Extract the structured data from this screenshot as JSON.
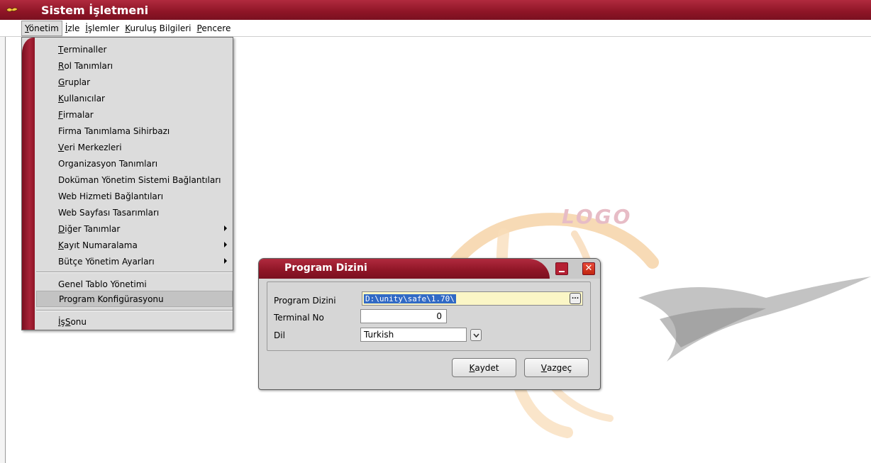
{
  "app": {
    "title": "Sistem İşletmeni"
  },
  "menubar": [
    {
      "ul": "Y",
      "rest": "önetim"
    },
    {
      "ul": "İ",
      "rest": "zle"
    },
    {
      "ul": "İ",
      "rest": "şlemler"
    },
    {
      "ul": "K",
      "rest": "uruluş Bilgileri"
    },
    {
      "ul": "P",
      "rest": "encere"
    }
  ],
  "menu": {
    "items": [
      {
        "ul": "T",
        "rest": "erminaller"
      },
      {
        "ul": "R",
        "rest": "ol Tanımları"
      },
      {
        "ul": "G",
        "rest": "ruplar"
      },
      {
        "ul": "K",
        "rest": "ullanıcılar"
      },
      {
        "ul": "F",
        "rest": "irmalar"
      },
      {
        "ul": "",
        "rest": "Firma Tanımlama Sihirbazı"
      },
      {
        "ul": "V",
        "rest": "eri Merkezleri"
      },
      {
        "ul": "",
        "rest": "Organizasyon Tanımları"
      },
      {
        "ul": "",
        "rest": "Doküman Yönetim Sistemi Bağlantıları"
      },
      {
        "ul": "",
        "rest": "Web Hizmeti Bağlantıları"
      },
      {
        "ul": "",
        "rest": "Web Sayfası Tasarımları"
      },
      {
        "ul": "D",
        "rest": "iğer Tanımlar"
      },
      {
        "ul": "K",
        "rest": "ayıt Numaralama"
      },
      {
        "ul": "",
        "rest": "Bütçe Yönetim Ayarları"
      },
      {
        "ul": "",
        "rest": "Genel Tablo Yönetimi"
      },
      {
        "ul": "",
        "rest": "Program Konfigürasyonu"
      },
      {
        "ul": "İ",
        "rest": "ş ",
        "ul2": "S",
        "rest2": "onu"
      }
    ]
  },
  "logo": {
    "text": "LOGO"
  },
  "dialog": {
    "title": "Program Dizini",
    "fields": {
      "program_dir_label": "Program Dizini",
      "program_dir_value": "D:\\unity\\safe\\1.70\\",
      "terminal_label": "Terminal No",
      "terminal_value": "0",
      "lang_label": "Dil",
      "lang_value": "Turkish"
    },
    "buttons": {
      "save": {
        "ul": "K",
        "rest": "aydet"
      },
      "cancel": {
        "ul": "V",
        "rest": "azgeç"
      }
    },
    "close_glyph": "✕",
    "browse_glyph": "..."
  },
  "icons": {
    "app_icon": "app-logo-icon",
    "submenu_arrow": "chevron-right-icon",
    "dropdown": "chevron-down-icon"
  }
}
